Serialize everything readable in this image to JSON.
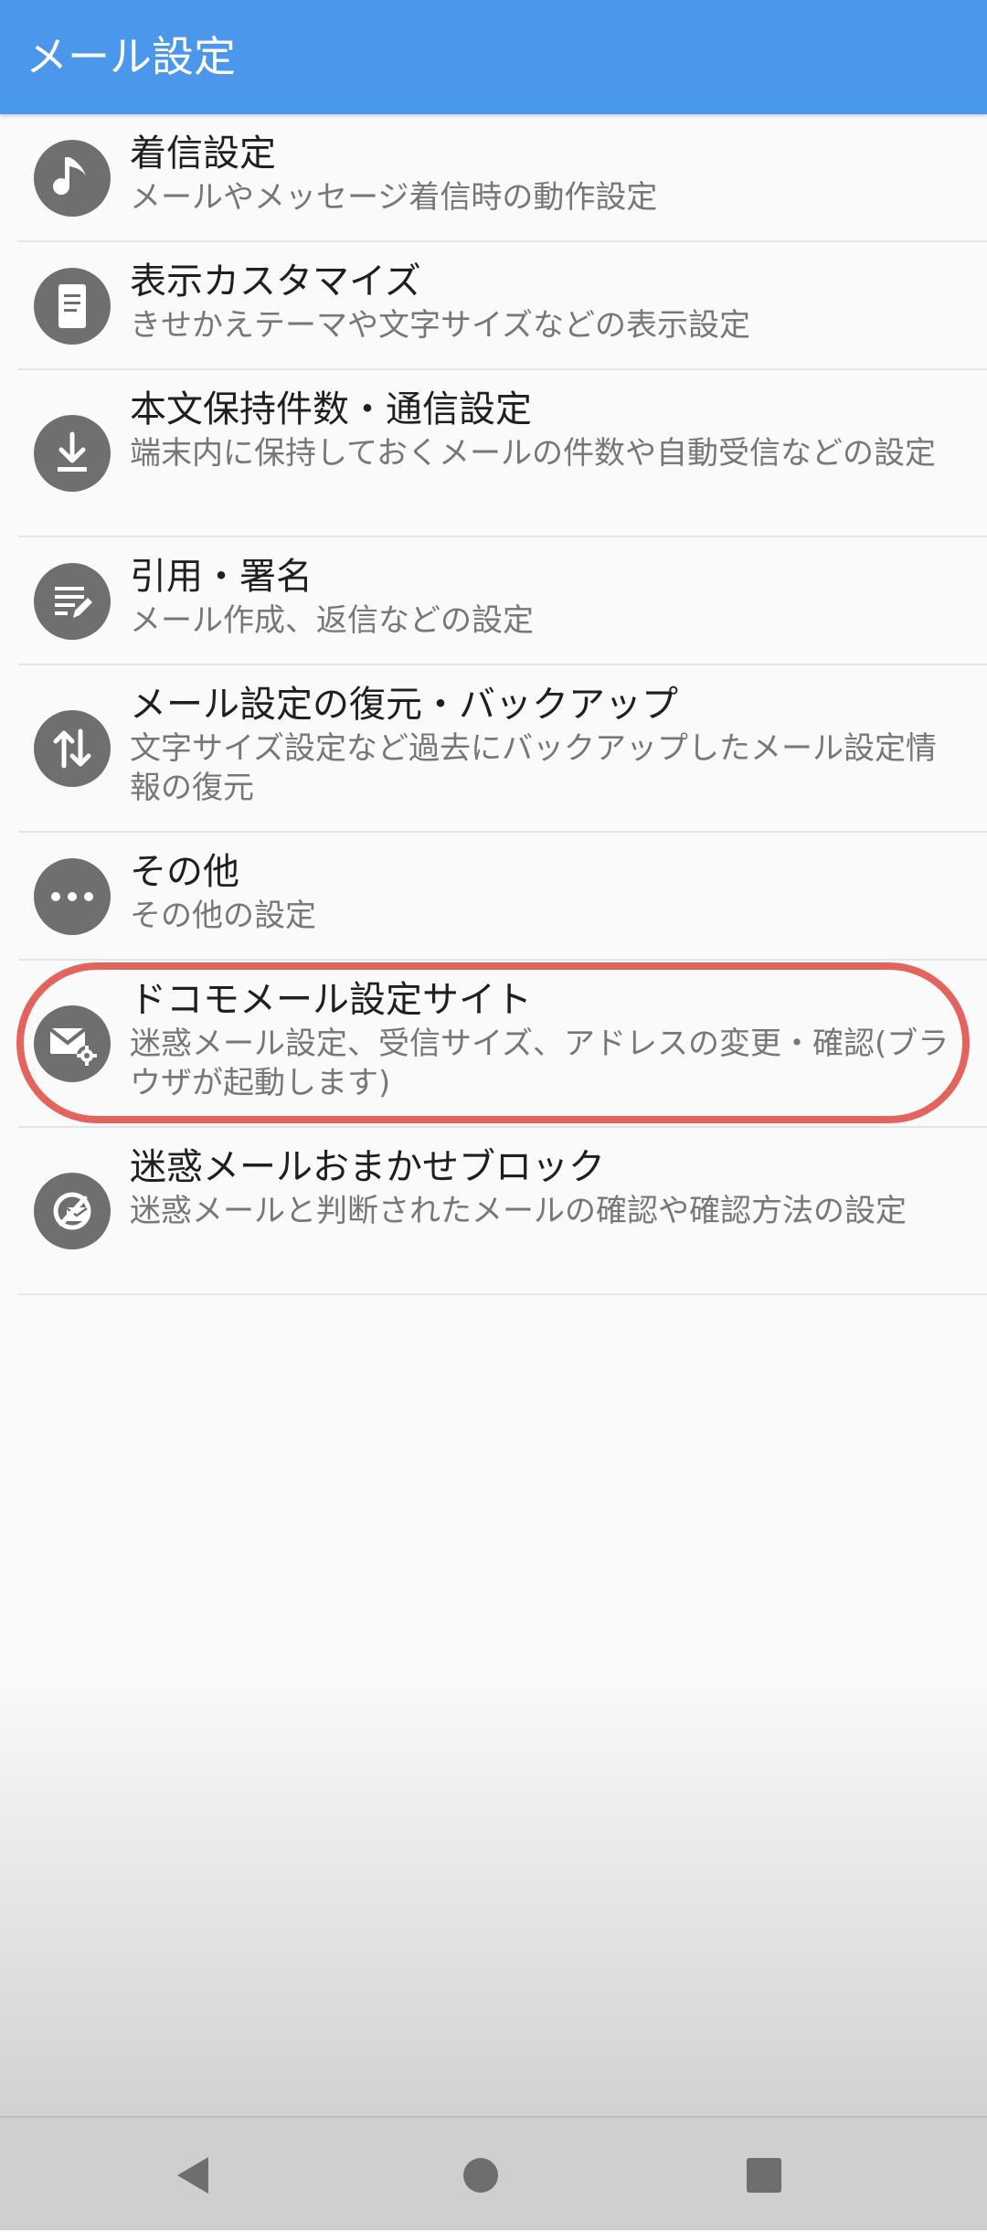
{
  "app_bar": {
    "title": "メール設定"
  },
  "items": [
    {
      "label": "着信設定",
      "desc": "メールやメッセージ着信時の動作設定",
      "icon": "music-note-icon"
    },
    {
      "label": "表示カスタマイズ",
      "desc": "きせかえテーマや文字サイズなどの表示設定",
      "icon": "phone-display-icon"
    },
    {
      "label": "本文保持件数・通信設定",
      "desc": "端末内に保持しておくメールの件数や自動受信などの設定",
      "icon": "download-icon"
    },
    {
      "label": "引用・署名",
      "desc": "メール作成、返信などの設定",
      "icon": "edit-lines-icon"
    },
    {
      "label": "メール設定の復元・バックアップ",
      "desc": "文字サイズ設定など過去にバックアップしたメール設定情報の復元",
      "icon": "swap-vertical-icon"
    },
    {
      "label": "その他",
      "desc": "その他の設定",
      "icon": "more-dots-icon"
    },
    {
      "label": "ドコモメール設定サイト",
      "desc": "迷惑メール設定、受信サイズ、アドレスの変更・確認(ブラウザが起動します)",
      "icon": "mail-settings-icon"
    },
    {
      "label": "迷惑メールおまかせブロック",
      "desc": "迷惑メールと判断されたメールの確認や確認方法の設定",
      "icon": "spam-block-icon"
    }
  ],
  "highlight": {
    "item_index": 6,
    "color": "#e3645f"
  },
  "colors": {
    "app_bar": "#4a97ec",
    "icon_bg": "#6f6f6f"
  },
  "nav": {
    "back": "back-icon",
    "home": "home-icon",
    "recents": "recents-icon"
  }
}
